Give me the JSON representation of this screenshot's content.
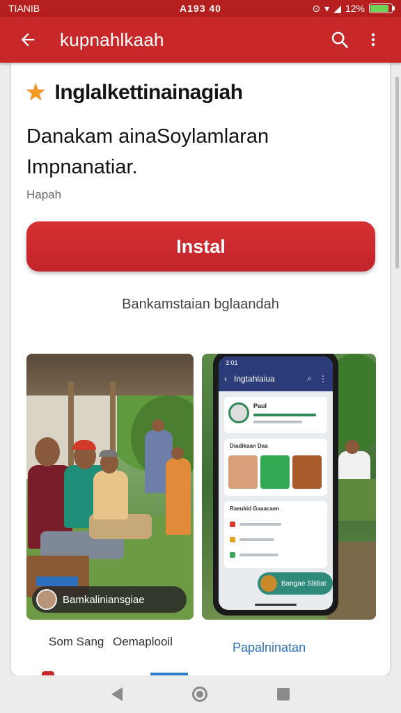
{
  "status_bar": {
    "left": "TIANIB",
    "center": "A193 40",
    "right": "12%",
    "battery_level": 0.85,
    "icons": [
      "alarm-icon",
      "wifi-icon",
      "signal-icon",
      "battery-icon"
    ]
  },
  "app_bar": {
    "title": "kupnahlkaah",
    "back_icon": "arrow-left-icon",
    "search_icon": "search-icon",
    "menu_icon": "more-vert-icon",
    "color": "#c9282a"
  },
  "app": {
    "name": "Inglalkettinainagiah",
    "star_icon": "star-icon",
    "description": "Danakam ainaSoylamlaran Impnanatiar.",
    "subtitle": "Hapah",
    "install_label": "Instal",
    "install_color": "#c9282a",
    "note": "Bankamstaian bglaandah"
  },
  "screenshots": {
    "left_caption": "Bamkaliniansgiae",
    "phone": {
      "status": "3:01",
      "title": "Ingtahlaiua",
      "profile_name": "Paul",
      "section1_title": "Diadikaan Daa",
      "section2_title": "Raeukid Gaaacaen",
      "fab_label": "Bangae Slidiat"
    }
  },
  "footer": {
    "label1": "Som Sang",
    "label2": "Oemaplooil",
    "link": "Papalninatan"
  },
  "nav_bar": {
    "back_icon": "nav-back-icon",
    "home_icon": "nav-home-icon",
    "recents_icon": "nav-recents-icon"
  }
}
